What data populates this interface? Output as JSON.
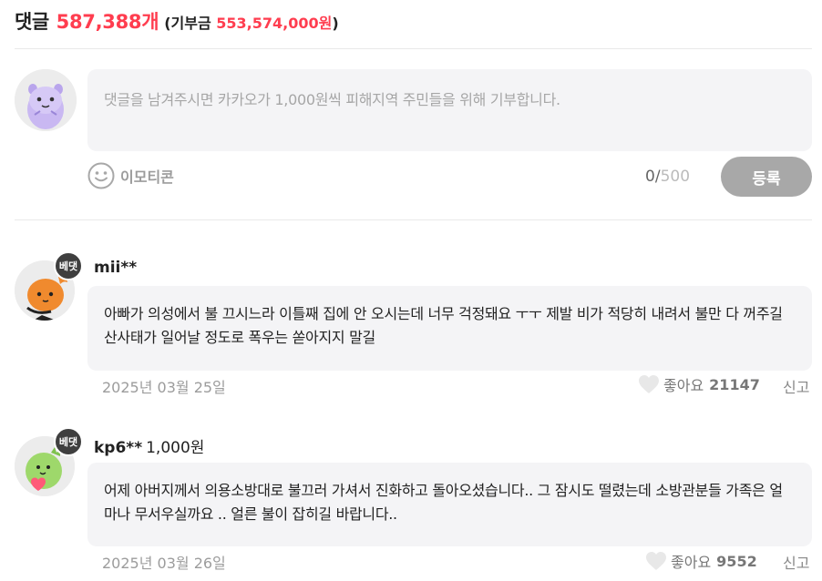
{
  "header": {
    "label": "댓글",
    "count": "587,388개",
    "donation_prefix": "(기부금 ",
    "donation_amount": "553,574,000원",
    "donation_suffix": ")"
  },
  "composer": {
    "placeholder": "댓글을 남겨주시면 카카오가 1,000원씩 피해지역 주민들을 위해 기부합니다.",
    "emoticon_label": "이모티콘",
    "char_count": "0",
    "char_separator": "/",
    "char_max": "500",
    "submit_label": "등록"
  },
  "comments": [
    {
      "badge": "베댓",
      "author": "mii**",
      "donation": "",
      "text": "아빠가 의성에서 불 끄시느라 이틀째 집에 안 오시는데 너무 걱정돼요 ㅜㅜ 제발 비가 적당히 내려서 불만 다 꺼주길 산사태가 일어날 정도로 폭우는 쏟아지지 말길",
      "date": "2025년 03월 25일",
      "like_label": "좋아요",
      "like_count": "21147",
      "report_label": "신고"
    },
    {
      "badge": "베댓",
      "author": "kp6**",
      "donation": "1,000원",
      "text": "어제 아버지께서 의용소방대로 불끄러 가셔서 진화하고 돌아오셨습니다.. 그 잠시도 떨렸는데 소방관분들 가족은 얼마나 무서우실까요 .. 얼른 불이 잡히길 바랍니다..",
      "date": "2025년 03월 26일",
      "like_label": "좋아요",
      "like_count": "9552",
      "report_label": "신고"
    }
  ],
  "colors": {
    "accent": "#ff3d4f",
    "bubble_bg": "#f4f4f6",
    "button_disabled": "#a8a8a8"
  },
  "icons": {
    "emoticon": "smiley-face-icon",
    "like": "heart-icon"
  }
}
